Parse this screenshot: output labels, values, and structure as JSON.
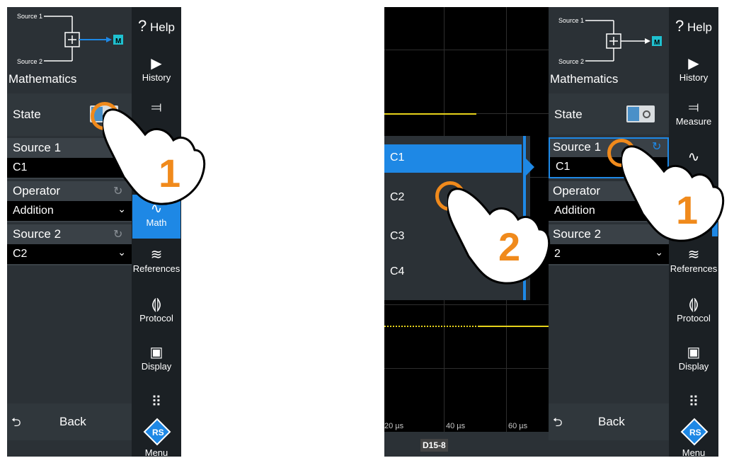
{
  "left": {
    "diagram": {
      "source1": "Source 1",
      "source2": "Source 2",
      "out": "M"
    },
    "title": "Mathematics",
    "state_label": "State",
    "source1_label": "Source 1",
    "source1_value": "C1",
    "operator_label": "Operator",
    "operator_value": "Addition",
    "source2_label": "Source 2",
    "source2_value": "C2",
    "back": "Back",
    "nav": {
      "help": "Help",
      "help_mark": "?",
      "history": "History",
      "math": "Math",
      "references": "References",
      "protocol": "Protocol",
      "display": "Display",
      "menu": "Menu"
    },
    "step": "1"
  },
  "right": {
    "diagram": {
      "source1": "Source 1",
      "source2": "Source 2",
      "out": "M"
    },
    "title": "Mathematics",
    "state_label": "State",
    "source1_label": "Source 1",
    "source1_value": "C1",
    "operator_label": "Operator",
    "operator_value": "Addition",
    "source2_label": "Source 2",
    "source2_value": "2",
    "back": "Back",
    "nav": {
      "help": "Help",
      "help_mark": "?",
      "history": "History",
      "measure": "Measure",
      "references": "References",
      "protocol": "Protocol",
      "display": "Display",
      "menu": "Menu"
    },
    "popup": [
      "C1",
      "C2",
      "C3",
      "C4"
    ],
    "scope_ticks": [
      "20 µs",
      "40 µs",
      "60 µs"
    ],
    "tab": "D15-8",
    "step1": "1",
    "step2": "2"
  },
  "colors": {
    "accent": "#1e88e5",
    "touch": "#f08a1c",
    "trace": "#e6d21a"
  }
}
